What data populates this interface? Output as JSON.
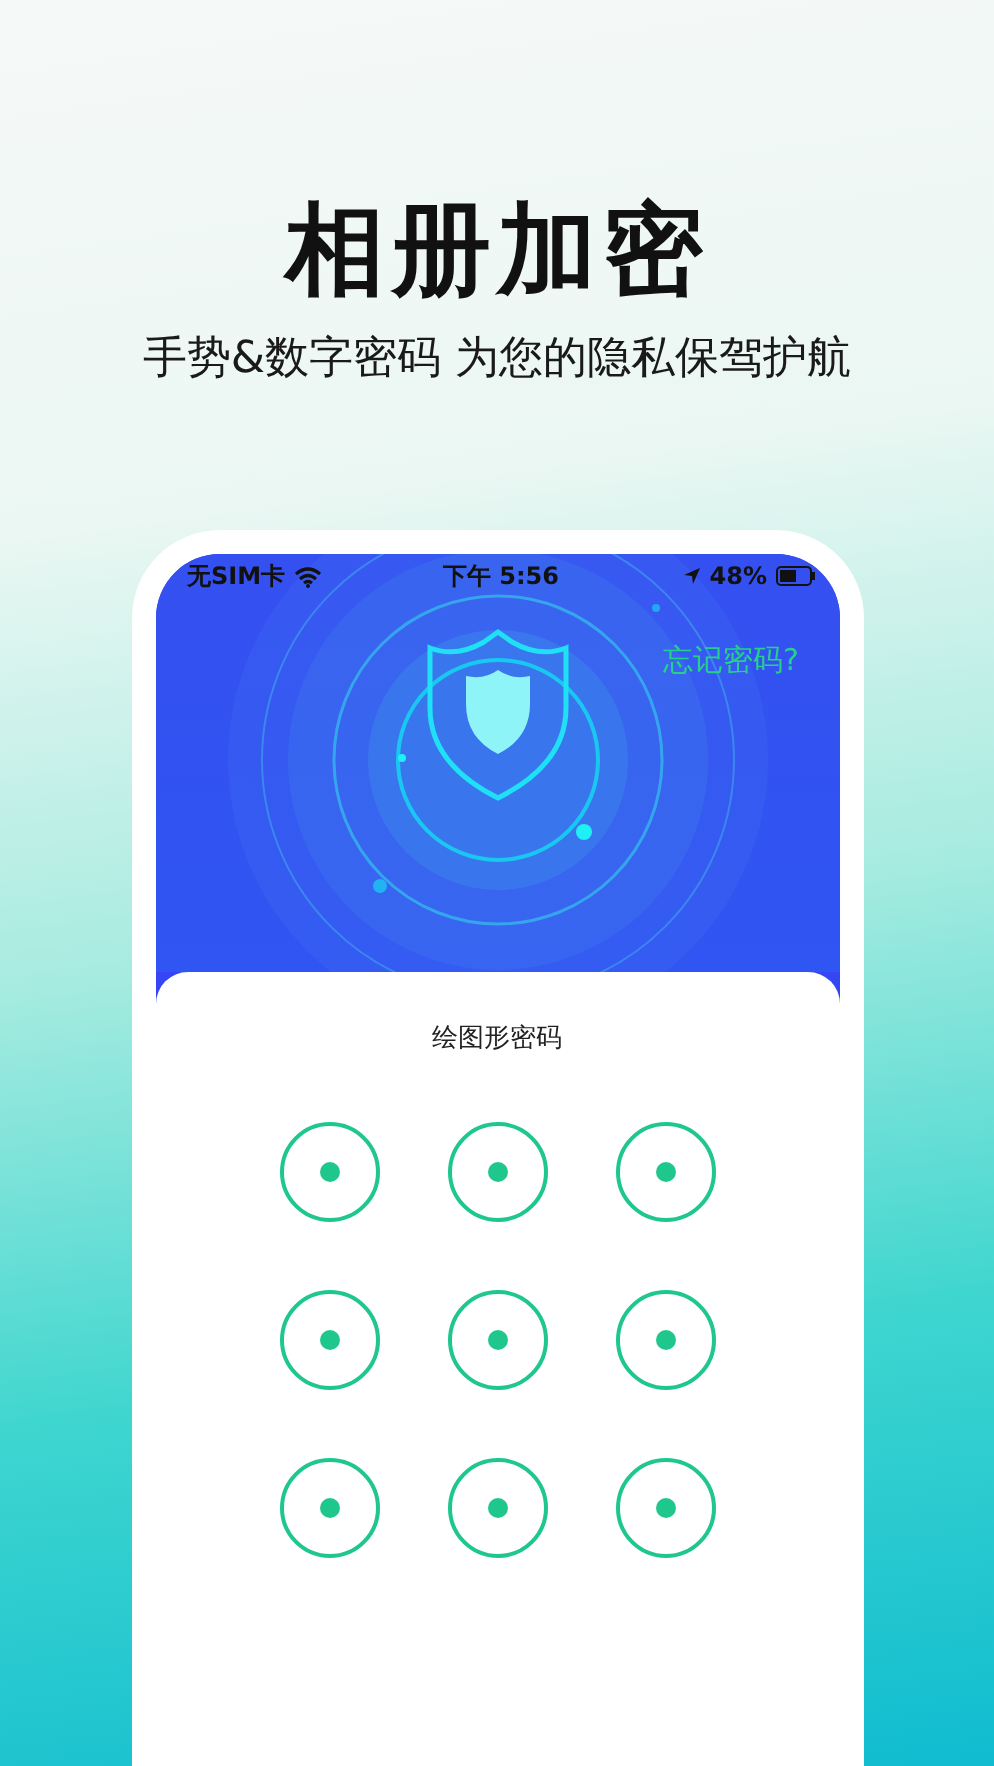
{
  "headline": "相册加密",
  "subtitle": "手势&数字密码 为您的隐私保驾护航",
  "status_bar": {
    "carrier": "无SIM卡",
    "time": "下午 5:56",
    "battery": "48%"
  },
  "forgot_link": "忘记密码?",
  "pattern": {
    "label": "绘图形密码",
    "nodes": [
      {
        "selected": false
      },
      {
        "selected": false
      },
      {
        "selected": false
      },
      {
        "selected": false
      },
      {
        "selected": false
      },
      {
        "selected": false
      },
      {
        "selected": false
      },
      {
        "selected": false
      },
      {
        "selected": false
      }
    ]
  }
}
